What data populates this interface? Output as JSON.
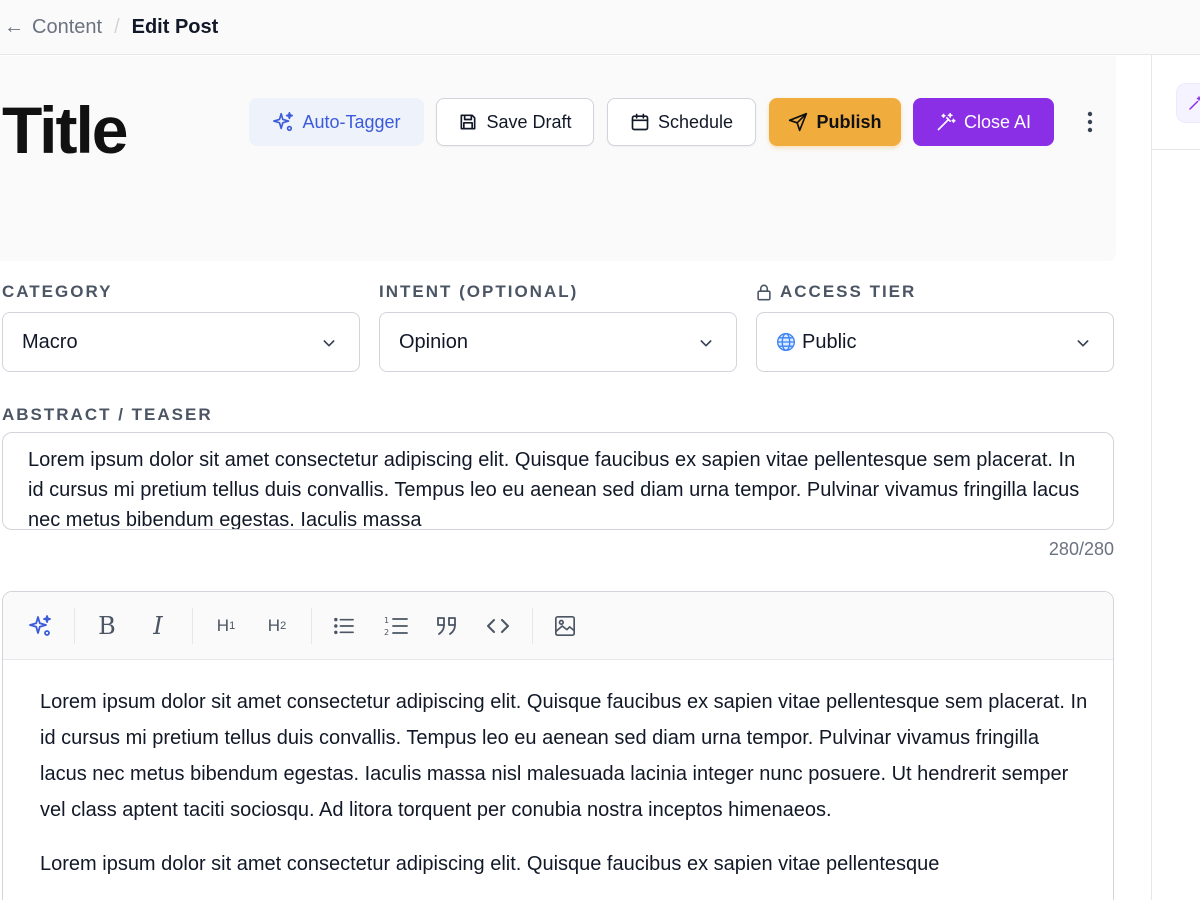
{
  "breadcrumb": {
    "parent": "Content",
    "separator": "/",
    "current": "Edit Post"
  },
  "header": {
    "title": "Title",
    "buttons": {
      "auto_tagger": "Auto-Tagger",
      "save_draft": "Save Draft",
      "schedule": "Schedule",
      "publish": "Publish",
      "close_ai": "Close AI"
    }
  },
  "fields": {
    "category": {
      "label": "CATEGORY",
      "value": "Macro"
    },
    "intent": {
      "label": "INTENT (OPTIONAL)",
      "value": "Opinion"
    },
    "access_tier": {
      "label": "ACCESS TIER",
      "value": "Public",
      "value_icon": "globe-icon"
    },
    "abstract": {
      "label": "ABSTRACT / TEASER",
      "value": "Lorem ipsum dolor sit amet consectetur adipiscing elit. Quisque faucibus ex sapien vitae pellentesque sem placerat. In id cursus mi pretium tellus duis convallis. Tempus leo eu aenean sed diam urna tempor. Pulvinar vivamus fringilla lacus nec metus bibendum egestas. Iaculis massa",
      "counter": "280/280"
    }
  },
  "editor": {
    "toolbar": {
      "ai_icon": "sparkles-icon",
      "bold": "B",
      "italic": "I",
      "h1": "H",
      "h1_sub": "1",
      "h2": "H",
      "h2_sub": "2",
      "bullet_list_icon": "bullet-list-icon",
      "ordered_list_icon": "ordered-list-icon",
      "quote_icon": "quote-icon",
      "code_icon": "code-icon",
      "image_icon": "image-icon"
    },
    "paragraphs": [
      "Lorem ipsum dolor sit amet consectetur adipiscing elit. Quisque faucibus ex sapien vitae pellentesque sem placerat. In id cursus mi pretium tellus duis convallis. Tempus leo eu aenean sed diam urna tempor. Pulvinar vivamus fringilla lacus nec metus bibendum egestas. Iaculis massa nisl malesuada lacinia integer nunc posuere. Ut hendrerit semper vel class aptent taciti sociosqu. Ad litora torquent per conubia nostra inceptos himenaeos.",
      "Lorem ipsum dolor sit amet consectetur adipiscing elit. Quisque faucibus ex sapien vitae pellentesque"
    ]
  },
  "colors": {
    "publish": "#f0ad3e",
    "close_ai": "#8b2fe6",
    "auto_tagger_text": "#3b5bdb",
    "spellcheck": "#e11d48"
  }
}
